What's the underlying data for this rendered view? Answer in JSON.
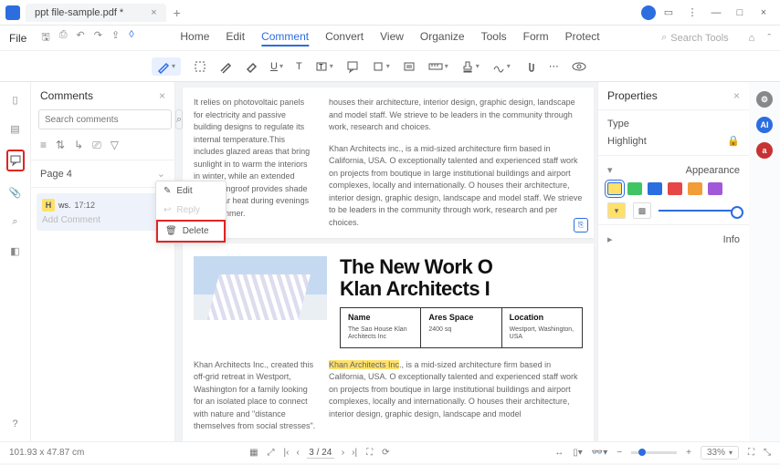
{
  "tab_title": "ppt file-sample.pdf *",
  "file_menu": "File",
  "menu_tabs": [
    "Home",
    "Edit",
    "Comment",
    "Convert",
    "View",
    "Organize",
    "Tools",
    "Form",
    "Protect"
  ],
  "menu_active": "Comment",
  "search_tools_ph": "Search Tools",
  "comments": {
    "title": "Comments",
    "search_ph": "Search comments",
    "page_label": "Page 4",
    "user": "ws.",
    "time": "17:12",
    "badge": "H",
    "add_ph": "Add Comment"
  },
  "ctx": {
    "edit": "Edit",
    "reply": "Reply",
    "delete": "Delete"
  },
  "doc": {
    "para1": "It relies on photovoltaic panels for electricity and passive building designs to regulate its internal temperature.This includes glazed areas that bring sunlight in to warm the interiors in winter, while an extended west-facingroof provides shade from solar heat during evenings inthe summer.",
    "para2": "houses their architecture, interior design, graphic design, landscape and model staff. We strieve to be leaders in the community through work, research and choices.",
    "para3": "Khan Architects inc., is a mid-sized architecture firm based in California, USA. O exceptionally talented and experienced staff work on projects from boutique in large institutional buildings and airport complexes, locally and internationally. O houses their architecture, interior design, graphic design, landscape and model staff. We strieve to be leaders in the community through work, research and per choices.",
    "h1a": "The New Work O",
    "h1b": "Klan Architects I",
    "tbl": {
      "name_h": "Name",
      "name_v": "The Sao House Klan Architects Inc",
      "area_h": "Ares Space",
      "area_v": "2400 sq",
      "loc_h": "Location",
      "loc_v": "Westport, Washington, USA"
    },
    "para4": "Khan Architects Inc., created this off-grid retreat in Westport, Washington for a family looking for an isolated place to connect with nature and \"distance themselves from social stresses\".",
    "para5a": "Khan Architects Inc",
    "para5b": "., is a mid-sized architecture firm based in California, USA. O exceptionally talented and experienced staff work on projects from boutique in large institutional buildings and airport complexes, locally and internationally. O houses their architecture, interior design, graphic design, landscape and model"
  },
  "props": {
    "title": "Properties",
    "type": "Type",
    "highlight": "Highlight",
    "appearance": "Appearance",
    "info": "Info",
    "colors": [
      "#ffe16a",
      "#41c464",
      "#2c6de0",
      "#e74646",
      "#f29d38",
      "#a259d9"
    ]
  },
  "status": {
    "coords": "101.93 x 47.87 cm",
    "page": "3 / 24",
    "zoom": "33%"
  }
}
